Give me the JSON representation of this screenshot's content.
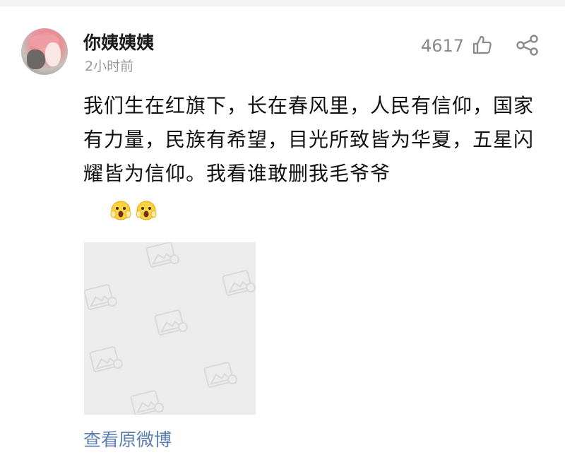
{
  "post": {
    "username": "你姨姨姨",
    "time": "2小时前",
    "likes": "4617",
    "content": "我们生在红旗下，长在春风里，人民有信仰，国家有力量，民族有希望，目光所致皆为华夏，五星闪耀皆为信仰。我看谁敢删我毛爷爷",
    "emojis": [
      "scared-face-emoji",
      "scared-face-emoji"
    ],
    "view_original": "查看原微博"
  },
  "icons": {
    "like": "thumbs-up-icon",
    "share": "share-icon",
    "image_placeholder": "image-placeholder-icon"
  },
  "colors": {
    "username": "#1a1a1a",
    "meta": "#9a9a9a",
    "link": "#5b7fb0",
    "placeholder_bg": "#ececec"
  }
}
